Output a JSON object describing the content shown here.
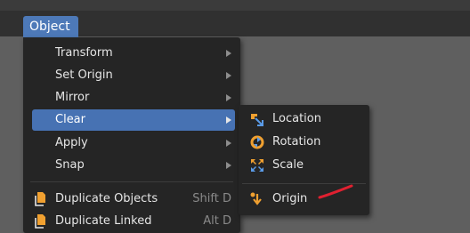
{
  "header": {
    "object_menu_label": "Object"
  },
  "object_menu": {
    "items": [
      {
        "label": "Transform",
        "has_submenu": true
      },
      {
        "label": "Set Origin",
        "has_submenu": true
      },
      {
        "label": "Mirror",
        "has_submenu": true
      },
      {
        "label": "Clear",
        "has_submenu": true,
        "active": true
      },
      {
        "label": "Apply",
        "has_submenu": true
      },
      {
        "label": "Snap",
        "has_submenu": true
      },
      {
        "label": "Duplicate Objects",
        "shortcut": "Shift D",
        "icon": "duplicate-icon"
      },
      {
        "label": "Duplicate Linked",
        "shortcut": "Alt D",
        "icon": "duplicate-linked-icon"
      }
    ]
  },
  "clear_submenu": {
    "items": [
      {
        "label": "Location",
        "icon": "location-icon"
      },
      {
        "label": "Rotation",
        "icon": "rotation-icon"
      },
      {
        "label": "Scale",
        "icon": "scale-icon"
      },
      {
        "label": "Origin",
        "icon": "origin-icon"
      }
    ]
  },
  "colors": {
    "accent": "#4772b3",
    "menu_background": "#252525",
    "icon_orange": "#f0a030",
    "icon_blue": "#5a9be8",
    "annotation_red": "#e02030"
  }
}
